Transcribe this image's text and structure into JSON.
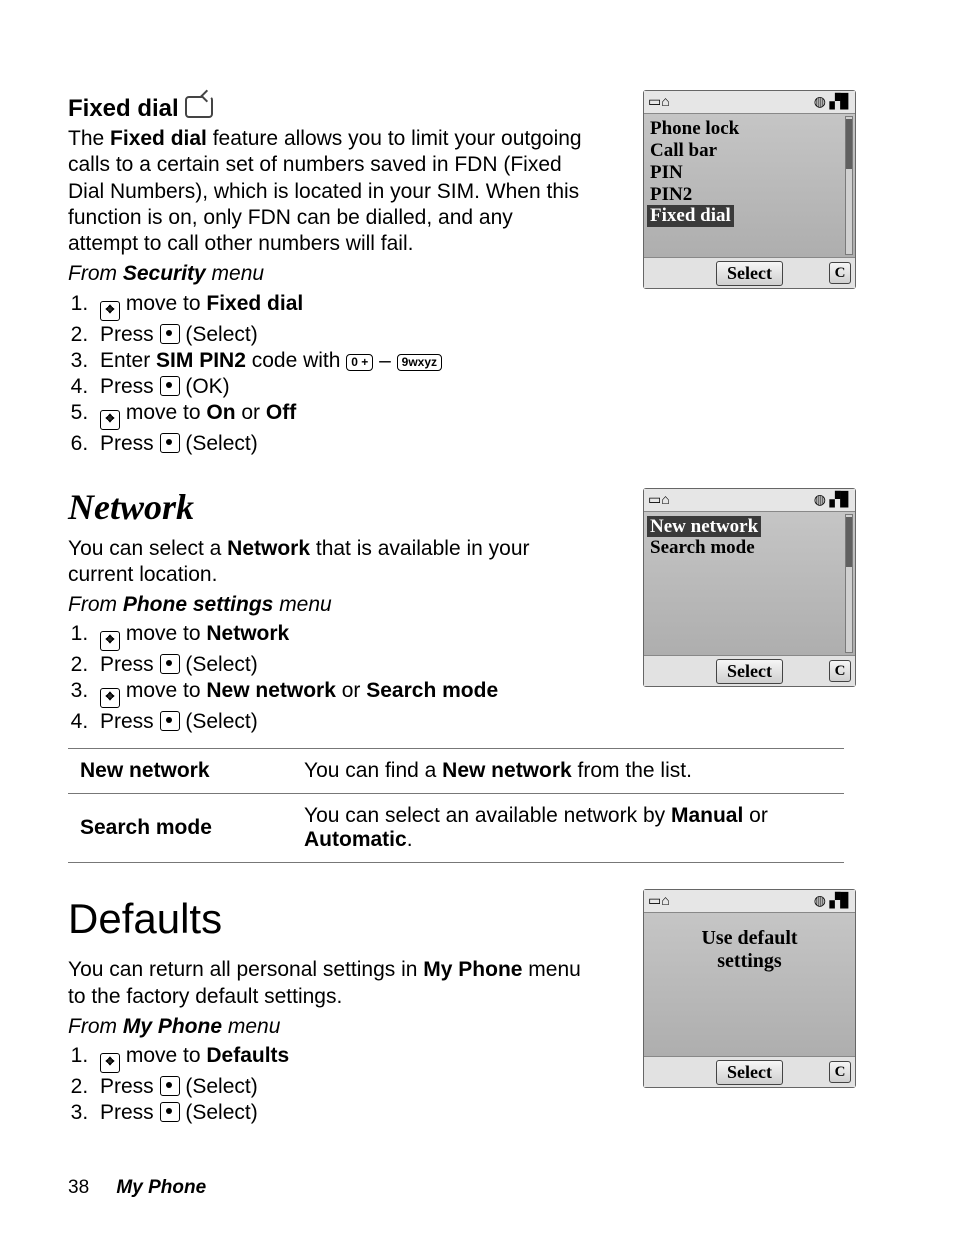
{
  "footer": {
    "page": "38",
    "section": "My Phone"
  },
  "sec_fixed": {
    "title": "Fixed dial",
    "intro": {
      "a": "The ",
      "b": "Fixed dial",
      "c": " feature allows you to limit your outgoing calls to a certain set of numbers saved in FDN (Fixed Dial Numbers), which is located in your SIM. When this function is on, only FDN can be dialled, and any attempt to call other numbers will fail."
    },
    "from": {
      "a": "From ",
      "b": "Security",
      "c": " menu"
    },
    "steps": {
      "s1": {
        "a": " move to ",
        "b": "Fixed dial"
      },
      "s2": {
        "a": "Press ",
        "b": " (Select)"
      },
      "s3": {
        "a": "Enter ",
        "b": "SIM PIN2",
        "c": " code with ",
        "k1": "0 +",
        "dash": " – ",
        "k2": "9wxyz"
      },
      "s4": {
        "a": "Press ",
        "b": " (OK)"
      },
      "s5": {
        "a": " move to ",
        "b": "On",
        "c": " or ",
        "d": "Off"
      },
      "s6": {
        "a": "Press ",
        "b": " (Select)"
      }
    }
  },
  "sec_network": {
    "title": "Network",
    "intro": {
      "a": "You can select a ",
      "b": "Network",
      "c": " that is available in your current location."
    },
    "from": {
      "a": "From ",
      "b": "Phone settings",
      "c": " menu"
    },
    "steps": {
      "s1": {
        "a": " move to ",
        "b": "Network"
      },
      "s2": {
        "a": "Press ",
        "b": " (Select)"
      },
      "s3": {
        "a": " move to ",
        "b": "New network",
        "c": " or ",
        "d": "Search mode"
      },
      "s4": {
        "a": "Press ",
        "b": " (Select)"
      }
    },
    "table": {
      "r1": {
        "l": "New network",
        "a": "You can find a ",
        "b": "New network",
        "c": " from the list."
      },
      "r2": {
        "l": "Search mode",
        "a": "You can select an available network by ",
        "b": "Manual",
        "c": " or ",
        "d": "Automatic",
        "e": "."
      }
    }
  },
  "sec_defaults": {
    "title": "Defaults",
    "intro": {
      "a": "You can return all personal settings in ",
      "b": "My Phone",
      "c": " menu to the factory default settings."
    },
    "from": {
      "a": "From ",
      "b": "My Phone",
      "c": " menu"
    },
    "steps": {
      "s1": {
        "a": " move to ",
        "b": "Defaults"
      },
      "s2": {
        "a": "Press ",
        "b": " (Select)"
      },
      "s3": {
        "a": "Press ",
        "b": " (Select)"
      }
    }
  },
  "shot_common": {
    "select": "Select",
    "c": "C",
    "status_l": "▭⌂",
    "status_r": "◍   ▞▊"
  },
  "shot1": {
    "l1": "Phone lock",
    "l2": "Call bar",
    "l3": "PIN",
    "l4": "PIN2",
    "l5": "Fixed dial"
  },
  "shot2": {
    "l1": "New network",
    "l2": "Search mode"
  },
  "shot3": {
    "msg1": "Use default",
    "msg2": "settings"
  }
}
